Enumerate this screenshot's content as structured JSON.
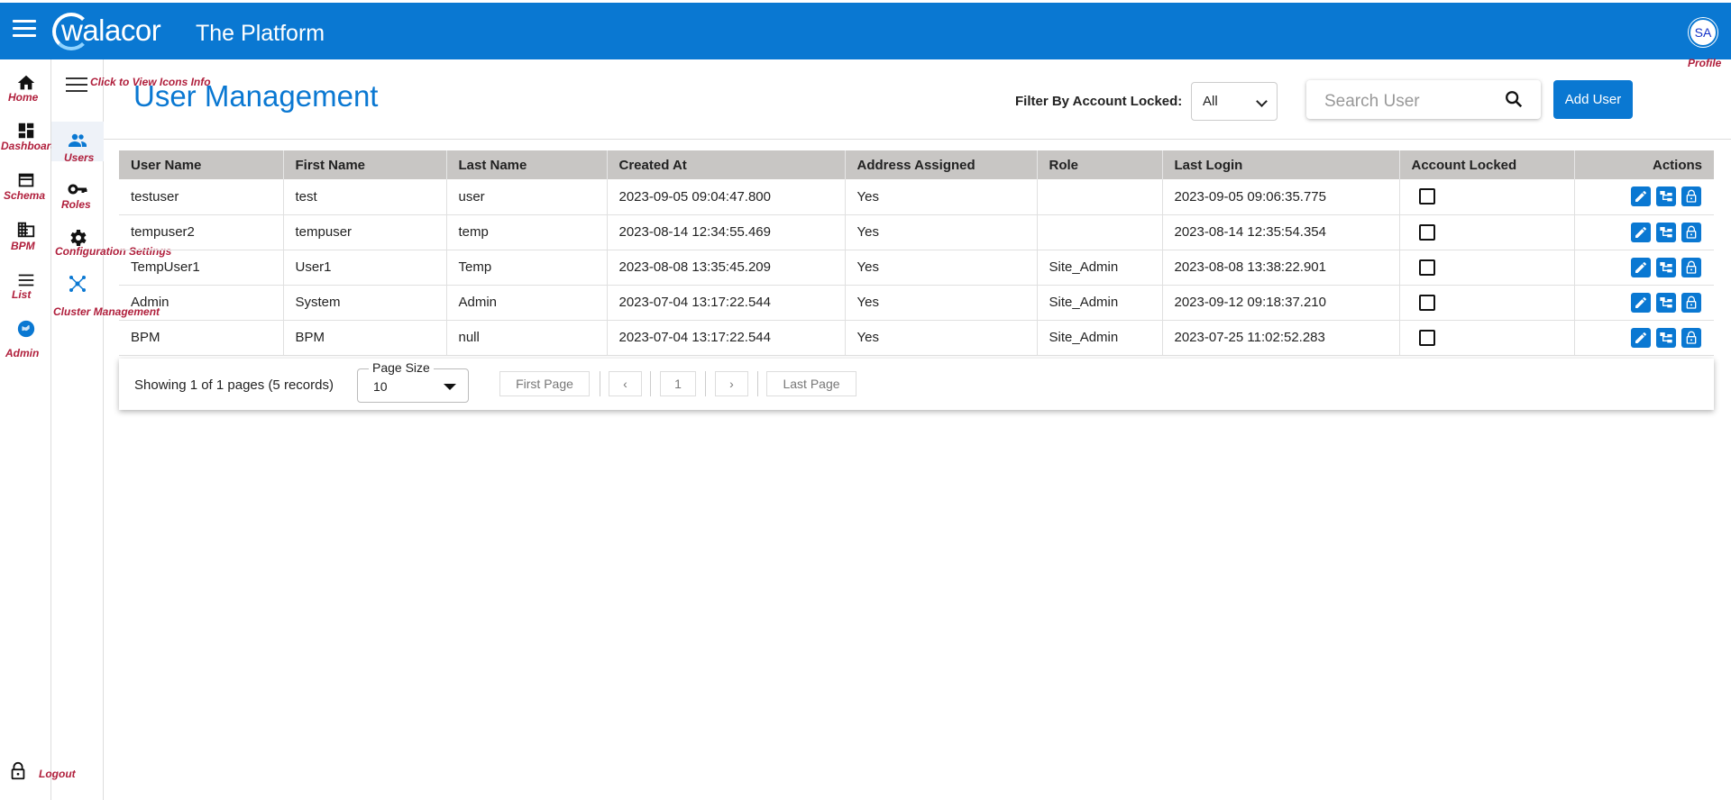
{
  "topbar": {
    "brand": "walacor",
    "app_title": "The Platform",
    "avatar_initials": "SA",
    "profile_label": "Profile"
  },
  "left_nav": {
    "home": "Home",
    "dashboard": "Dashboard",
    "schema": "Schema",
    "bpm": "BPM",
    "list": "List",
    "admin": "Admin",
    "logout": "Logout"
  },
  "sub_nav": {
    "tip": "Click to View Icons Info",
    "users": "Users",
    "roles": "Roles",
    "config": "Configuration Settings",
    "cluster": "Cluster Management"
  },
  "page": {
    "title": "User Management",
    "filter_label": "Filter By Account Locked:",
    "filter_value": "All",
    "search_placeholder": "Search User",
    "add_user": "Add User"
  },
  "table": {
    "headers": [
      "User Name",
      "First Name",
      "Last Name",
      "Created At",
      "Address Assigned",
      "Role",
      "Last Login",
      "Account Locked",
      "Actions"
    ],
    "rows": [
      [
        "testuser",
        "test",
        "user",
        "2023-09-05 09:04:47.800",
        "Yes",
        "",
        "2023-09-05 09:06:35.775"
      ],
      [
        "tempuser2",
        "tempuser",
        "temp",
        "2023-08-14 12:34:55.469",
        "Yes",
        "",
        "2023-08-14 12:35:54.354"
      ],
      [
        "TempUser1",
        "User1",
        "Temp",
        "2023-08-08 13:35:45.209",
        "Yes",
        "Site_Admin",
        "2023-08-08 13:38:22.901"
      ],
      [
        "Admin",
        "System",
        "Admin",
        "2023-07-04 13:17:22.544",
        "Yes",
        "Site_Admin",
        "2023-09-12 09:18:37.210"
      ],
      [
        "BPM",
        "BPM",
        "null",
        "2023-07-04 13:17:22.544",
        "Yes",
        "Site_Admin",
        "2023-07-25 11:02:52.283"
      ]
    ]
  },
  "pager": {
    "showing": "Showing 1 of 1 pages (5 records)",
    "page_size_label": "Page Size",
    "page_size_value": "10",
    "first": "First Page",
    "prev": "‹",
    "current": "1",
    "next": "›",
    "last": "Last Page"
  },
  "colors": {
    "brand_blue": "#0a78d2",
    "header_gray": "#c8c6c4",
    "label_red": "#b01f3c"
  }
}
